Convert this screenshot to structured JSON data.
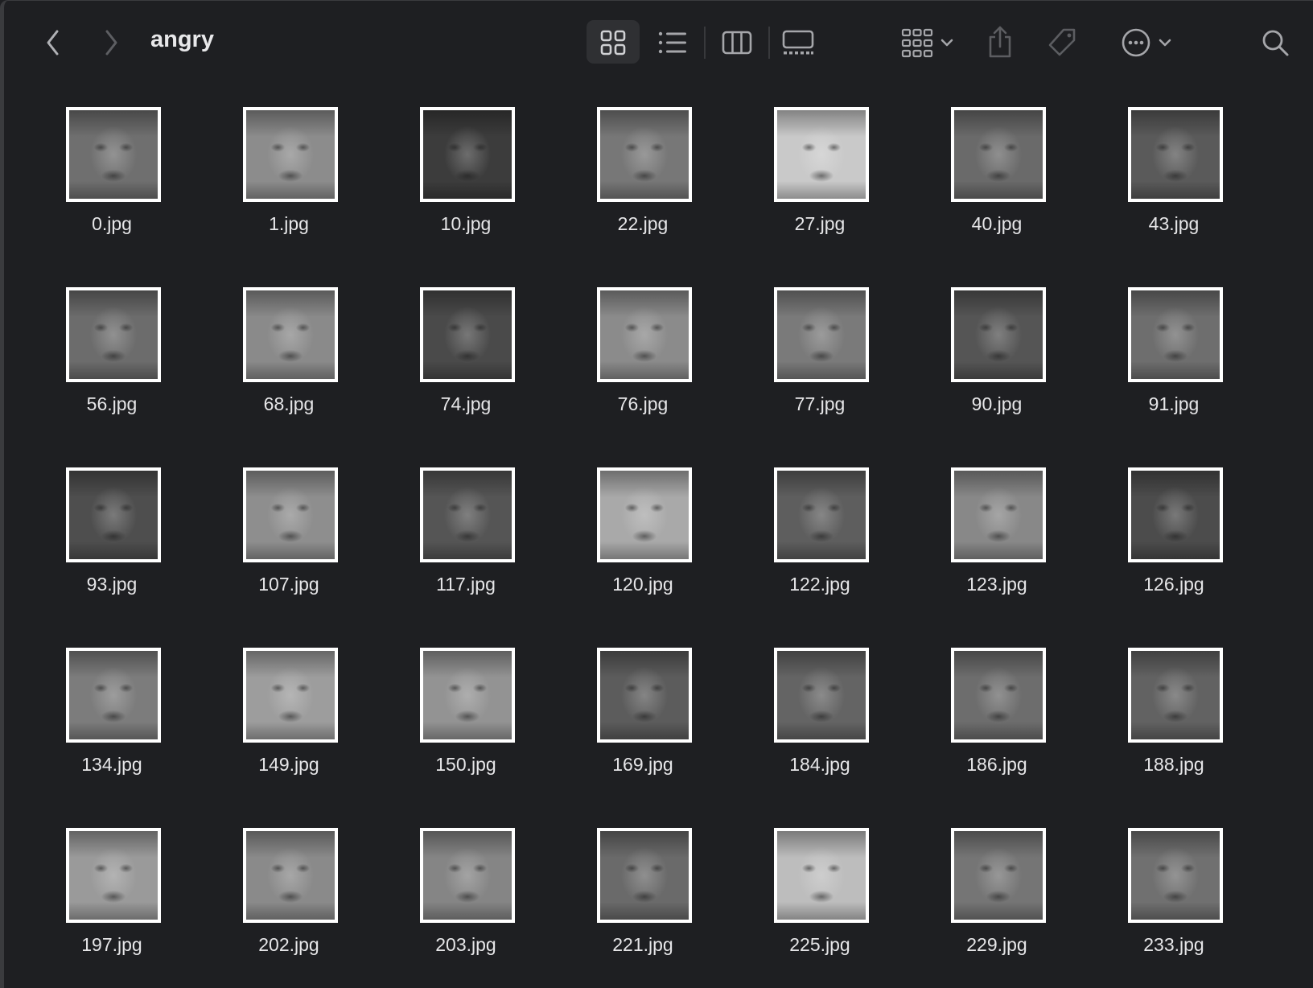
{
  "window": {
    "folder_title": "angry"
  },
  "toolbar": {
    "back_icon": "chevron-left-icon",
    "forward_icon": "chevron-right-icon",
    "view_modes": [
      "icon-view",
      "list-view",
      "column-view",
      "gallery-view"
    ],
    "active_view": "icon-view",
    "group_icon": "group-by-icon",
    "share_icon": "share-icon",
    "tag_icon": "tag-icon",
    "more_icon": "more-actions-icon",
    "search_icon": "search-icon"
  },
  "files": [
    {
      "name": "0.jpg",
      "tone": "#6f6f6f"
    },
    {
      "name": "1.jpg",
      "tone": "#8c8c8c"
    },
    {
      "name": "10.jpg",
      "tone": "#3c3c3c"
    },
    {
      "name": "22.jpg",
      "tone": "#777777"
    },
    {
      "name": "27.jpg",
      "tone": "#c9c9c9"
    },
    {
      "name": "40.jpg",
      "tone": "#6a6a6a"
    },
    {
      "name": "43.jpg",
      "tone": "#5a5a5a"
    },
    {
      "name": "56.jpg",
      "tone": "#6c6c6c"
    },
    {
      "name": "68.jpg",
      "tone": "#8a8a8a"
    },
    {
      "name": "74.jpg",
      "tone": "#4a4a4a"
    },
    {
      "name": "76.jpg",
      "tone": "#8b8b8b"
    },
    {
      "name": "77.jpg",
      "tone": "#7a7a7a"
    },
    {
      "name": "90.jpg",
      "tone": "#555555"
    },
    {
      "name": "91.jpg",
      "tone": "#6e6e6e"
    },
    {
      "name": "93.jpg",
      "tone": "#4e4e4e"
    },
    {
      "name": "107.jpg",
      "tone": "#8e8e8e"
    },
    {
      "name": "117.jpg",
      "tone": "#555555"
    },
    {
      "name": "120.jpg",
      "tone": "#a9a9a9"
    },
    {
      "name": "122.jpg",
      "tone": "#5e5e5e"
    },
    {
      "name": "123.jpg",
      "tone": "#888888"
    },
    {
      "name": "126.jpg",
      "tone": "#4c4c4c"
    },
    {
      "name": "134.jpg",
      "tone": "#7c7c7c"
    },
    {
      "name": "149.jpg",
      "tone": "#9d9d9d"
    },
    {
      "name": "150.jpg",
      "tone": "#939393"
    },
    {
      "name": "169.jpg",
      "tone": "#5c5c5c"
    },
    {
      "name": "184.jpg",
      "tone": "#646464"
    },
    {
      "name": "186.jpg",
      "tone": "#6d6d6d"
    },
    {
      "name": "188.jpg",
      "tone": "#626262"
    },
    {
      "name": "197.jpg",
      "tone": "#9a9a9a"
    },
    {
      "name": "202.jpg",
      "tone": "#8a8a8a"
    },
    {
      "name": "203.jpg",
      "tone": "#858585"
    },
    {
      "name": "221.jpg",
      "tone": "#6a6a6a"
    },
    {
      "name": "225.jpg",
      "tone": "#bdbdbd"
    },
    {
      "name": "229.jpg",
      "tone": "#757575"
    },
    {
      "name": "233.jpg",
      "tone": "#707070"
    }
  ]
}
